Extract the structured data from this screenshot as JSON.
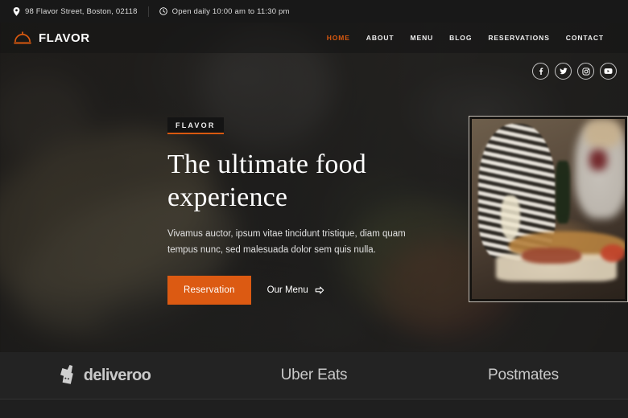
{
  "topbar": {
    "address": "98 Flavor Street, Boston, 02118",
    "address_icon": "location-pin-icon",
    "hours": "Open daily 10:00 am to 11:30 pm",
    "hours_icon": "clock-icon"
  },
  "nav": {
    "logo_icon": "cloche-dome-icon",
    "brand": "FLAVOR",
    "links": [
      {
        "label": "HOME",
        "active": true
      },
      {
        "label": "ABOUT",
        "active": false
      },
      {
        "label": "MENU",
        "active": false
      },
      {
        "label": "BLOG",
        "active": false
      },
      {
        "label": "RESERVATIONS",
        "active": false
      },
      {
        "label": "CONTACT",
        "active": false
      }
    ]
  },
  "social": [
    {
      "name": "facebook-icon"
    },
    {
      "name": "twitter-icon"
    },
    {
      "name": "instagram-icon"
    },
    {
      "name": "youtube-icon"
    }
  ],
  "hero": {
    "badge": "FLAVOR",
    "title": "The ultimate food experience",
    "description": "Vivamus auctor, ipsum vitae tincidunt tristique, diam quam tempus nunc, sed malesuada dolor sem quis nulla.",
    "primary_button": "Reservation",
    "secondary_button": "Our Menu",
    "secondary_icon": "arrow-right-icon",
    "inset_image_alt": "diners-with-wine-and-charcuterie-board"
  },
  "partners": [
    {
      "name": "deliveroo",
      "icon": "deliveroo-kangaroo-icon"
    },
    {
      "name": "Uber Eats",
      "icon": ""
    },
    {
      "name": "Postmates",
      "icon": ""
    }
  ],
  "colors": {
    "accent": "#d9590f",
    "button": "#dc5a12",
    "topbar_bg": "#181818",
    "partners_bg": "#232323",
    "text": "#ffffff"
  }
}
